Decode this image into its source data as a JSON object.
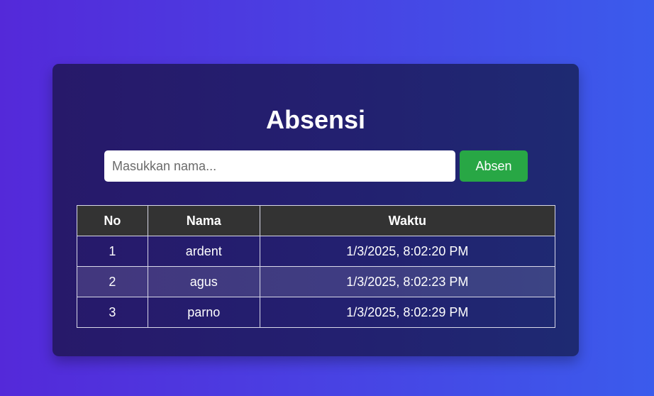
{
  "app": {
    "title": "Absensi"
  },
  "form": {
    "name_placeholder": "Masukkan nama...",
    "name_value": "",
    "submit_label": "Absen"
  },
  "table": {
    "headers": {
      "no": "No",
      "nama": "Nama",
      "waktu": "Waktu"
    },
    "rows": [
      {
        "no": "1",
        "nama": "ardent",
        "waktu": "1/3/2025, 8:02:20 PM"
      },
      {
        "no": "2",
        "nama": "agus",
        "waktu": "1/3/2025, 8:02:23 PM"
      },
      {
        "no": "3",
        "nama": "parno",
        "waktu": "1/3/2025, 8:02:29 PM"
      }
    ]
  },
  "colors": {
    "background_start": "#5429d9",
    "background_end": "#3b5bec",
    "card": "#232070",
    "button": "#28a745",
    "table_header": "#333333"
  }
}
